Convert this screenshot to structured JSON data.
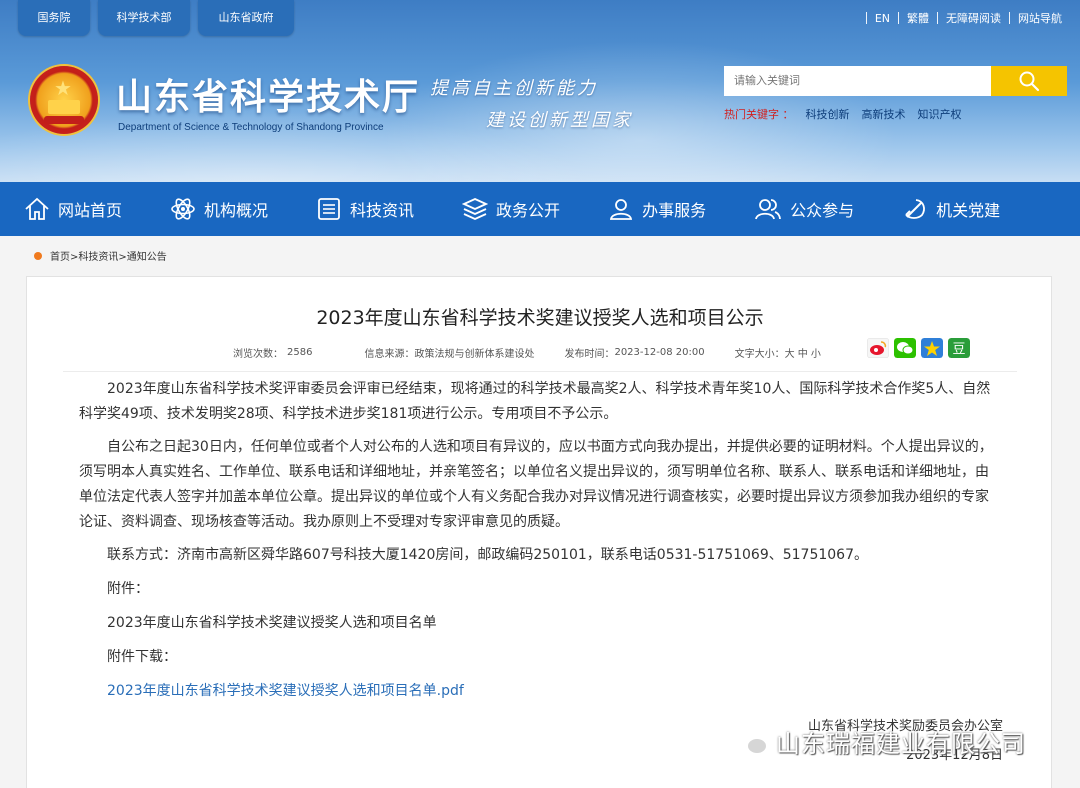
{
  "header": {
    "top_tabs": [
      "国务院",
      "科学技术部",
      "山东省政府"
    ],
    "util_links": [
      "EN",
      "繁體",
      "无障碍阅读",
      "网站导航"
    ],
    "site_title": "山东省科学技术厅",
    "site_subtitle": "Department of Science & Technology of Shandong Province",
    "slogan_line1": "提高自主创新能力",
    "slogan_line2": "建设创新型国家",
    "search_placeholder": "请输入关键词",
    "hot_label": "热门关键字 ：",
    "hot_keywords": [
      "科技创新",
      "高新技术",
      "知识产权"
    ]
  },
  "nav": [
    "网站首页",
    "机构概况",
    "科技资讯",
    "政务公开",
    "办事服务",
    "公众参与",
    "机关党建"
  ],
  "breadcrumb": "首页>科技资讯>通知公告",
  "article": {
    "title": "2023年度山东省科学技术奖建议授奖人选和项目公示",
    "meta": {
      "views_label": "浏览次数：",
      "views": "2586",
      "source_label": "信息来源：",
      "source": "政策法规与创新体系建设处",
      "time_label": "发布时间：",
      "time": "2023-12-08 20:00",
      "fontsize_label": "文字大小：",
      "fontsize_options": "大 中 小"
    },
    "paragraphs": [
      "2023年度山东省科学技术奖评审委员会评审已经结束，现将通过的科学技术最高奖2人、科学技术青年奖10人、国际科学技术合作奖5人、自然科学奖49项、技术发明奖28项、科学技术进步奖181项进行公示。专用项目不予公示。",
      "自公布之日起30日内，任何单位或者个人对公布的人选和项目有异议的，应以书面方式向我办提出，并提供必要的证明材料。个人提出异议的，须写明本人真实姓名、工作单位、联系电话和详细地址，并亲笔签名；以单位名义提出异议的，须写明单位名称、联系人、联系电话和详细地址，由单位法定代表人签字并加盖本单位公章。提出异议的单位或个人有义务配合我办对异议情况进行调查核实，必要时提出异议方须参加我办组织的专家论证、资料调查、现场核查等活动。我办原则上不受理对专家评审意见的质疑。",
      "联系方式：济南市高新区舜华路607号科技大厦1420房间，邮政编码250101，联系电话0531-51751069、51751067。",
      "附件：",
      "2023年度山东省科学技术奖建议授奖人选和项目名单",
      "附件下载："
    ],
    "attachment_link": "2023年度山东省科学技术奖建议授奖人选和项目名单.pdf",
    "signoff_org": "山东省科学技术奖励委员会办公室",
    "signoff_date": "2023年12月8日"
  },
  "watermark": "山东瑞福建业有限公司",
  "colors": {
    "nav_bg": "#1967c1",
    "search_btn": "#f5c400",
    "link": "#2a6eb8",
    "hot_label": "#d02020"
  }
}
